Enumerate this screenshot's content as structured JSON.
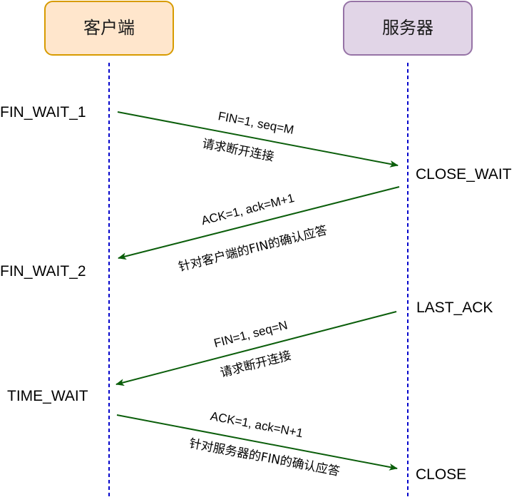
{
  "colors": {
    "client_fill": "#ffe6cc",
    "client_stroke": "#d79b00",
    "server_fill": "#e1d5e7",
    "server_stroke": "#9673a6",
    "lifeline": "#0000cc",
    "arrow": "#0b5e0b"
  },
  "participants": {
    "client": "客户端",
    "server": "服务器"
  },
  "states": {
    "client": [
      "FIN_WAIT_1",
      "FIN_WAIT_2",
      "TIME_WAIT"
    ],
    "server": [
      "CLOSE_WAIT",
      "LAST_ACK",
      "CLOSE"
    ]
  },
  "messages": [
    {
      "direction": "client-to-server",
      "label": "FIN=1, seq=M",
      "description": "请求断开连接"
    },
    {
      "direction": "server-to-client",
      "label": "ACK=1, ack=M+1",
      "description": "针对客户端的FIN的确认应答"
    },
    {
      "direction": "server-to-client",
      "label": "FIN=1, seq=N",
      "description": "请求断开连接"
    },
    {
      "direction": "client-to-server",
      "label": "ACK=1, ack=N+1",
      "description": "针对服务器的FIN的确认应答"
    }
  ]
}
